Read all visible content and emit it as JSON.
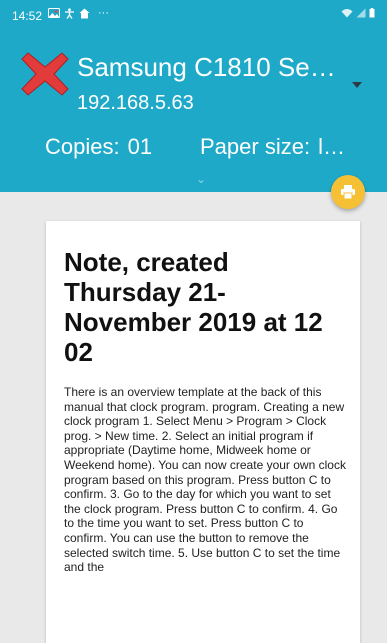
{
  "status_bar": {
    "time": "14:52",
    "notification_icons": [
      "photo-icon",
      "accessibility-icon",
      "home-icon"
    ],
    "more": "···",
    "system_icons": [
      "wifi-icon",
      "signal-icon",
      "battery-icon"
    ]
  },
  "header": {
    "printer_name": "Samsung C1810 Se…",
    "ip_address": "192.168.5.63",
    "copies_label": "Copies:",
    "copies_value": "01",
    "paper_size_label": "Paper size:",
    "paper_size_value": "l…",
    "color": "#1fa9c9"
  },
  "fab": {
    "icon": "print-icon",
    "color": "#f5c033"
  },
  "note": {
    "title": "Note, created Thursday 21-November 2019 at 12 02",
    "body": "There is an overview template at the back of this manual that clock program. program. Creating a new clock program 1. Select Menu > Program > Clock prog. > New time. 2. Select an initial program if appropriate (Daytime home, Midweek home or Weekend home). You can now create your own clock program based on this program. Press button C to confirm. 3. Go to the day for which you want to set the clock program. Press button C to confirm. 4. Go to the time you want to set. Press button C to confirm. You can use the button to remove the selected switch time. 5. Use button C to set the time and the"
  }
}
